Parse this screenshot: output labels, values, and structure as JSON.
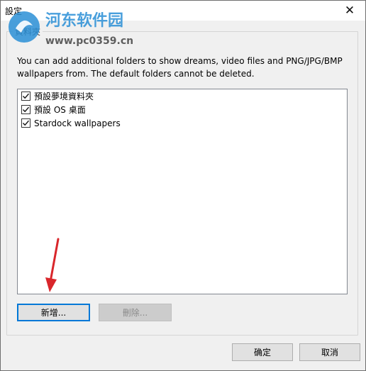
{
  "window": {
    "title": "設定",
    "close_glyph": "✕"
  },
  "watermark": {
    "name": "河东软件园",
    "url": "www.pc0359.cn"
  },
  "group": {
    "legend": "資料夾"
  },
  "description": "You can add additional folders to show dreams, video files and PNG/JPG/BMP wallpapers from.  The default folders cannot be deleted.",
  "folders": [
    {
      "label": "預設夢境資料夾",
      "checked": true
    },
    {
      "label": "預設 OS 桌面",
      "checked": true
    },
    {
      "label": "Stardock wallpapers",
      "checked": true
    }
  ],
  "buttons": {
    "add": "新增...",
    "delete": "刪除...",
    "ok": "确定",
    "cancel": "取消"
  },
  "colors": {
    "accent": "#0078d7",
    "annotation_arrow": "#d9262b"
  }
}
